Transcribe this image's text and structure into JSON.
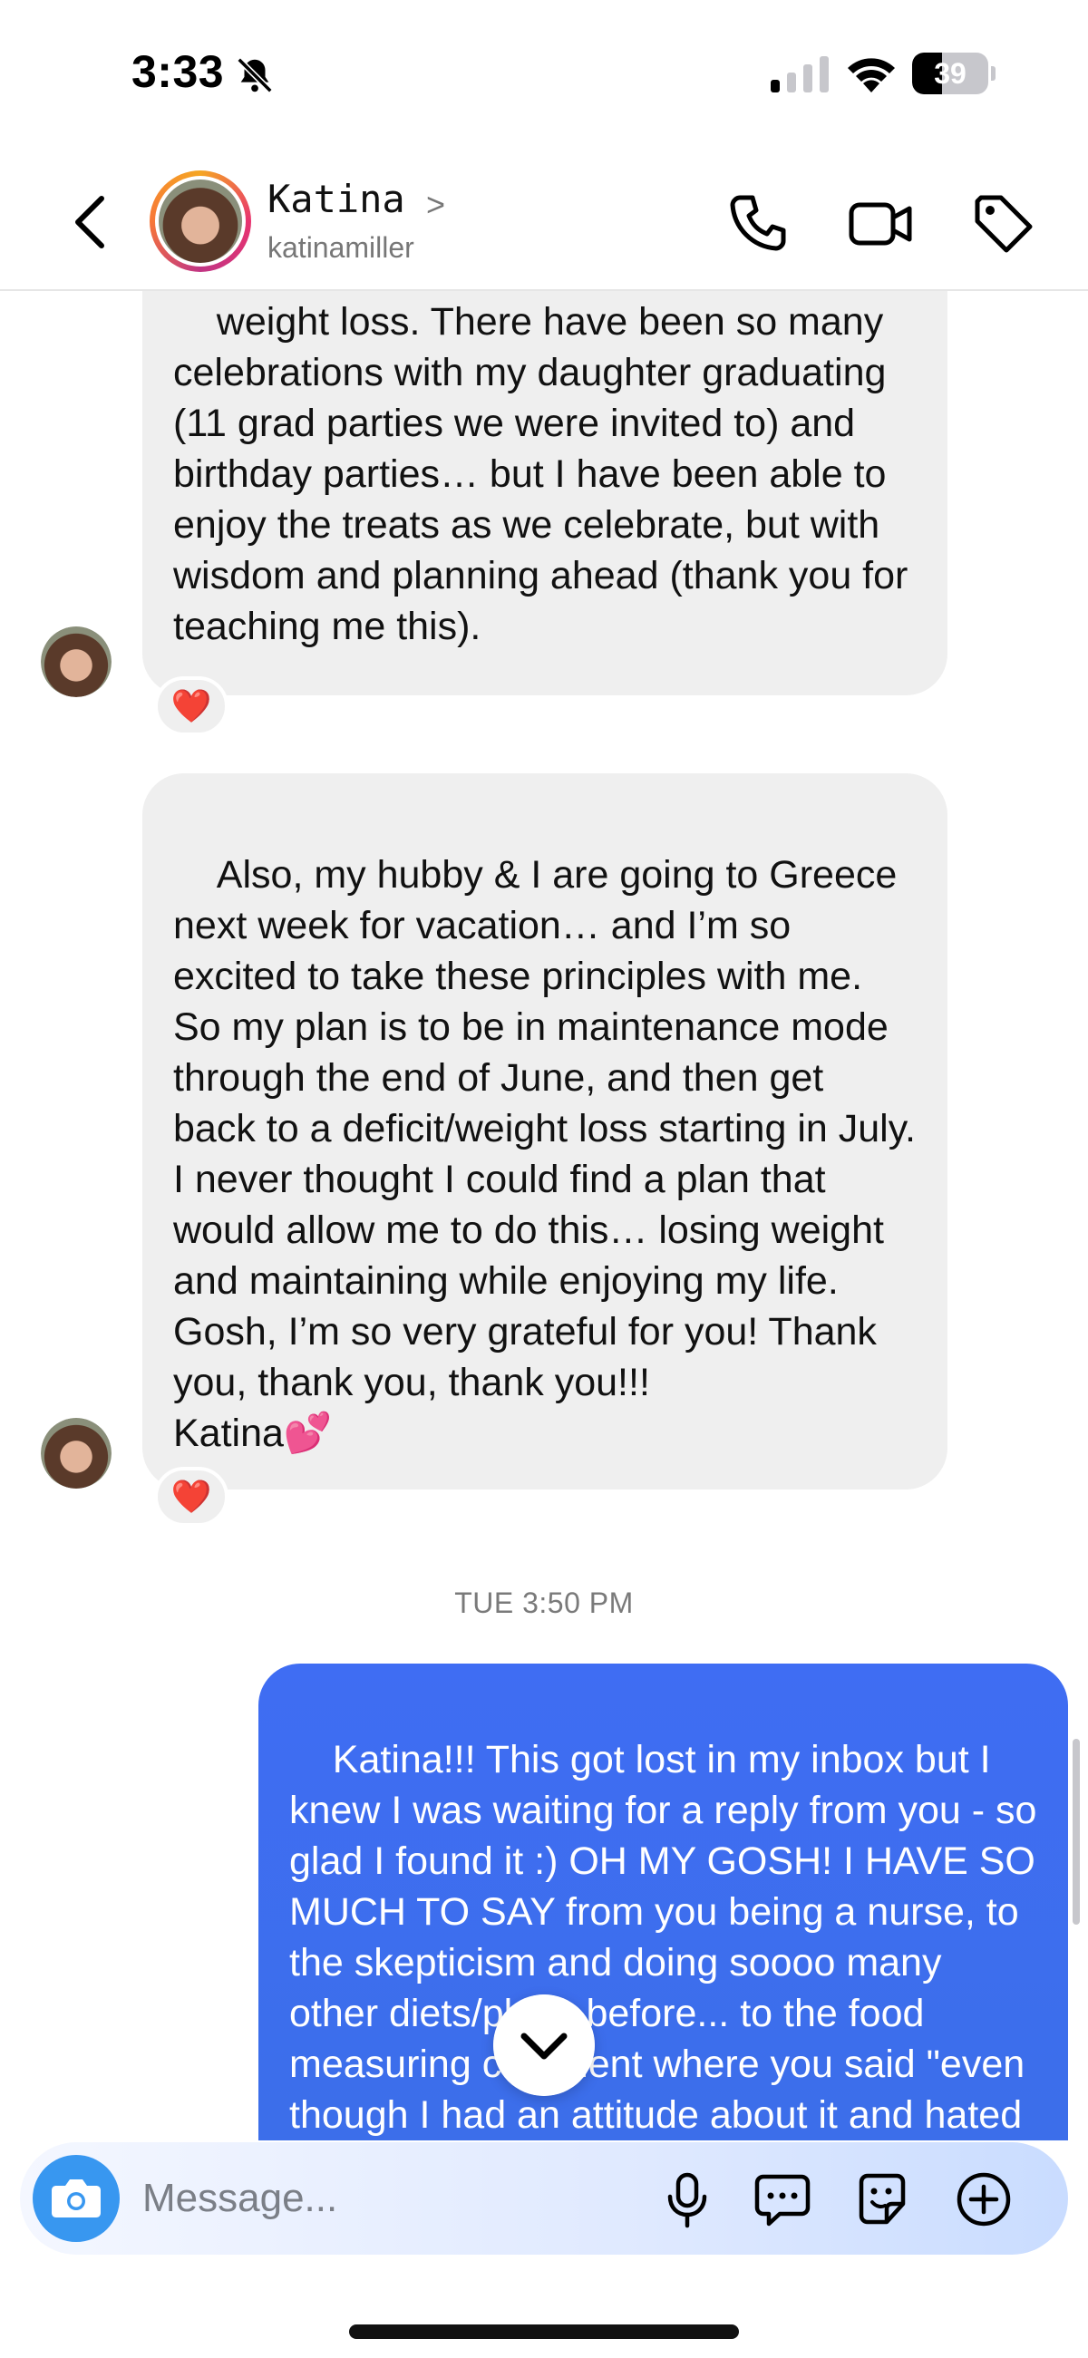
{
  "status_bar": {
    "time": "3:33",
    "battery_level": "39",
    "battery_fraction": 0.39
  },
  "header": {
    "contact_name": "Katina",
    "chevron": ">",
    "username": "katinamiller"
  },
  "messages": [
    {
      "direction": "incoming",
      "text": "weight loss. There have been so many celebrations with my daughter graduating (11 grad parties we were invited to) and birthday parties… but I have been able to enjoy the treats as we celebrate, but with wisdom and planning ahead (thank you for teaching me this).",
      "reaction": "❤️"
    },
    {
      "direction": "incoming",
      "text": "Also, my hubby & I are going to Greece next week for vacation… and I’m so excited to take these principles with me. So my plan is to be in maintenance mode through the end of June, and then get back to a deficit/weight loss starting in July. I never thought I could find a plan that would allow me to do this… losing weight and maintaining while enjoying my life. Gosh, I’m so very grateful for you! Thank you, thank you, thank you!!!\nKatina💕",
      "reaction": "❤️"
    },
    {
      "direction": "timestamp",
      "text": "TUE 3:50 PM"
    },
    {
      "direction": "outgoing",
      "text": "Katina!!! This got lost in my inbox but I knew I was waiting for a reply from you - so glad I found it :) OH MY GOSH! I HAVE SO MUCH TO SAY from you being a nurse, to the skepticism and doing soooo many other diets/plans before... to the food measuring comment where you said \"even though I had an attitude about it and hated doing it. Wellll, over"
    }
  ],
  "composer": {
    "placeholder": "Message..."
  },
  "icons": {
    "back": "chevron-left-icon",
    "phone": "phone-icon",
    "video": "video-camera-icon",
    "tag": "tag-icon",
    "camera": "camera-icon",
    "mic": "microphone-icon",
    "chat": "chat-bubble-icon",
    "sticker": "sticker-icon",
    "plus": "plus-circle-icon",
    "scroll_down": "chevron-down-icon"
  },
  "colors": {
    "outgoing_bubble": "#3f6df3",
    "incoming_bubble": "#efefef",
    "camera_button": "#3897f0",
    "reaction_heart": "#e0241b"
  }
}
